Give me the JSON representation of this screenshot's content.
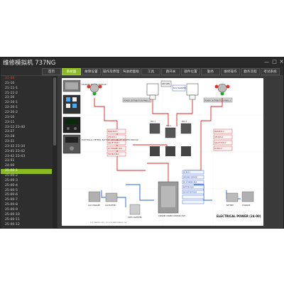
{
  "app": {
    "title": "维修模拟机 737NG"
  },
  "tabs": [
    {
      "label": "首页"
    },
    {
      "label": "系统图"
    },
    {
      "label": "故障设置"
    },
    {
      "label": "操作及原理"
    },
    {
      "label": "驾驶舱面板"
    },
    {
      "label": "工具"
    },
    {
      "label": "跳开关"
    },
    {
      "label": "部件位置"
    },
    {
      "label": "勤务"
    },
    {
      "label": "维修操作"
    },
    {
      "label": "勤务流程"
    },
    {
      "label": "考试系统"
    }
  ],
  "sidebar": {
    "items": [
      {
        "label": "21-00"
      },
      {
        "label": "21-10"
      },
      {
        "label": "21-11-1"
      },
      {
        "label": "21-11-2"
      },
      {
        "label": "21-20"
      },
      {
        "label": "22-10-1"
      },
      {
        "label": "22-20-1"
      },
      {
        "label": "22-20-2"
      },
      {
        "label": "23-10"
      },
      {
        "label": "23-11"
      },
      {
        "label": "23-12 23-40"
      },
      {
        "label": "23-27"
      },
      {
        "label": "23-28"
      },
      {
        "label": "23-31"
      },
      {
        "label": "23-32 23-34"
      },
      {
        "label": "23-41 23-42"
      },
      {
        "label": "23-42 23-43"
      },
      {
        "label": "23-51"
      },
      {
        "label": "24-00"
      },
      {
        "label": "25-00-1"
      },
      {
        "label": "25-00-2"
      },
      {
        "label": "25-00-3"
      },
      {
        "label": "25-00-4"
      },
      {
        "label": "25-00-5"
      },
      {
        "label": "25-00-6"
      },
      {
        "label": "25-00-7"
      },
      {
        "label": "25-00-8"
      },
      {
        "label": "25-00-9"
      },
      {
        "label": "25-00-10"
      },
      {
        "label": "25-00-11"
      },
      {
        "label": "25-00-12"
      }
    ]
  },
  "diagram": {
    "title": "ELECTRICAL POWER (24-00)",
    "labels": {
      "standby_module": "STANDBY POWER MODULE",
      "ac_ge": "AC GENERATOR",
      "electrical_meters": "ELECTRICAL METERS, BATTERY AND GALLEY POWER MODULE",
      "tpd_left": "POWER DISTRIBUTION PANEL 1",
      "tpd_right": "POWER DISTRIBUTION PANEL 2",
      "apu_gen": "APU GEN",
      "apu_bcu": "APU BCU",
      "bus_trans": "BUS TRANSFER",
      "main_bus_1": "MAIN BUS 1",
      "main_bus_2": "MAIN BUS 2",
      "xfr_bus_1": "XFR BUS 1",
      "xfr_bus_2": "XFR BUS 2",
      "galley_1": "GALLEY BUS 1",
      "galley_2": "GALLEY BUS 2",
      "tru_1": "TRU 1",
      "tru_2": "TRU 2",
      "tru_3": "TRU 3",
      "dc_bus_1": "DC BUS 1",
      "dc_bus_2": "DC BUS 2",
      "hot_bat": "HOT BAT BUS",
      "sw_hot_bat": "SW HOT BAT BUS",
      "bat_bus": "BATTERY BUS",
      "stby_ac": "AC STANDBY BUS",
      "stby_dc": "DC STANDBY BUS",
      "static_inv": "STATIC INVERTER",
      "aux_charger": "AUX CHARGER",
      "aux_battery": "AUX BATTERY",
      "battery": "BATTERY",
      "charger": "CHARGER",
      "stby_power_unit": "STANDBY POWER CONTROL UNIT",
      "ground_service": "GROUND SERVICE",
      "footnote": "FOR TRAINING ONLY - NOT FOR MAINTENANCE USE"
    }
  },
  "colors": {
    "accent": "#8bbb22",
    "window_bg": "#3a3a3a",
    "sidebar_header": "#e04030",
    "ac_line": "#e02020",
    "dc_line": "#2060e0",
    "panel_gray": "#d8d8d8"
  }
}
